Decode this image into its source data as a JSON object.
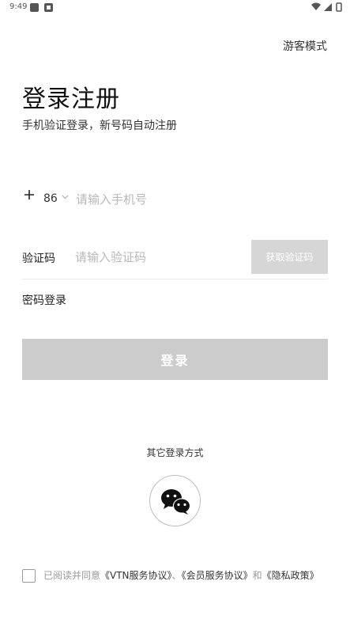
{
  "status_bar": {
    "time": "9:49"
  },
  "header": {
    "guest_mode": "游客模式"
  },
  "title": {
    "main": "登录注册",
    "subtitle": "手机验证登录，新号码自动注册"
  },
  "phone": {
    "country_code": "86",
    "placeholder": "请输入手机号"
  },
  "verification": {
    "label": "验证码",
    "placeholder": "请输入验证码",
    "get_code_label": "获取验证码"
  },
  "password_login": "密码登录",
  "login_button": "登录",
  "other_login": {
    "label": "其它登录方式",
    "icon": "wechat-icon"
  },
  "agreement": {
    "prefix": "已阅读并同意",
    "link1": "《VTN服务协议》",
    "sep1": "、",
    "link2": "《会员服务协议》",
    "sep2": "和",
    "link3": "《隐私政策》"
  },
  "colors": {
    "disabled_button": "#cccccc",
    "get_code_button": "#d6d6d6",
    "placeholder": "#b8b8b8",
    "muted_text": "#9a9a9a"
  }
}
